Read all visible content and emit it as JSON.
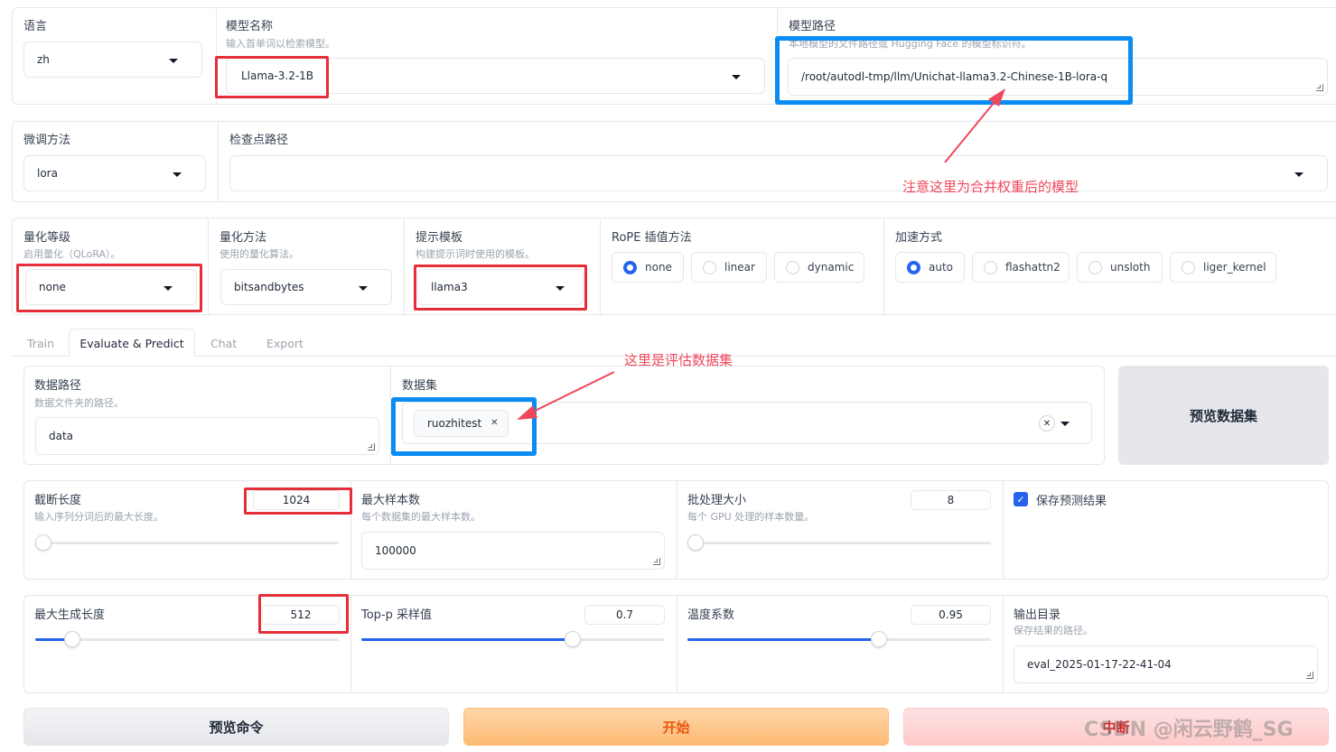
{
  "row1": {
    "lang": {
      "label": "语言",
      "value": "zh"
    },
    "model_name": {
      "label": "模型名称",
      "info": "输入首单词以检索模型。",
      "value": "Llama-3.2-1B"
    },
    "model_path": {
      "label": "模型路径",
      "info": "本地模型的文件路径或 Hugging Face 的模型标识符。",
      "value": "/root/autodl-tmp/llm/Unichat-llama3.2-Chinese-1B-lora-q"
    }
  },
  "row2": {
    "finetune": {
      "label": "微调方法",
      "value": "lora"
    },
    "checkpoint": {
      "label": "检查点路径",
      "value": ""
    }
  },
  "row3": {
    "quant_bit": {
      "label": "量化等级",
      "info": "启用量化（QLoRA）。",
      "value": "none"
    },
    "quant_method": {
      "label": "量化方法",
      "info": "使用的量化算法。",
      "value": "bitsandbytes"
    },
    "template": {
      "label": "提示模板",
      "info": "构建提示词时使用的模板。",
      "value": "llama3"
    },
    "rope": {
      "label": "RoPE 插值方法",
      "options": [
        "none",
        "linear",
        "dynamic"
      ],
      "selected": "none"
    },
    "booster": {
      "label": "加速方式",
      "options": [
        "auto",
        "flashattn2",
        "unsloth",
        "liger_kernel"
      ],
      "selected": "auto"
    }
  },
  "tabs": [
    "Train",
    "Evaluate & Predict",
    "Chat",
    "Export"
  ],
  "active_tab": "Evaluate & Predict",
  "eval": {
    "dataset_dir": {
      "label": "数据路径",
      "info": "数据文件夹的路径。",
      "value": "data"
    },
    "dataset": {
      "label": "数据集",
      "chips": [
        "ruozhitest"
      ]
    },
    "preview_dataset_label": "预览数据集",
    "cutoff_len": {
      "label": "截断长度",
      "info": "输入序列分词后的最大长度。",
      "value": "1024",
      "min": 4,
      "max": 65536,
      "current": 1024
    },
    "max_samples": {
      "label": "最大样本数",
      "info": "每个数据集的最大样本数。",
      "value": "100000"
    },
    "batch_size": {
      "label": "批处理大小",
      "info": "每个 GPU 处理的样本数量。",
      "value": "8",
      "min": 1,
      "max": 1024,
      "current": 8
    },
    "predict": {
      "label": "保存预测结果",
      "checked": true
    },
    "max_new_tokens": {
      "label": "最大生成长度",
      "value": "512",
      "min": 8,
      "max": 4096,
      "current": 512
    },
    "top_p": {
      "label": "Top-p 采样值",
      "value": "0.7",
      "min": 0.01,
      "max": 1,
      "current": 0.7
    },
    "temperature": {
      "label": "温度系数",
      "value": "0.95",
      "min": 0.01,
      "max": 1.5,
      "current": 0.95
    },
    "output_dir": {
      "label": "输出目录",
      "info": "保存结果的路径。",
      "value": "eval_2025-01-17-22-41-04"
    }
  },
  "buttons": {
    "preview_cmd": "预览命令",
    "start": "开始",
    "stop": "中断"
  },
  "annotations": {
    "merged_model_note": "注意这里为合并权重后的模型",
    "eval_dataset_note": "这里是评估数据集"
  },
  "watermark": "CSDN @闲云野鹤_SG",
  "colors": {
    "accent": "#2563eb",
    "annotation_red": "#e52e3a",
    "annotation_blue": "#0a8cf2",
    "start_btn": "#fdba74",
    "stop_btn": "#fecaca"
  }
}
